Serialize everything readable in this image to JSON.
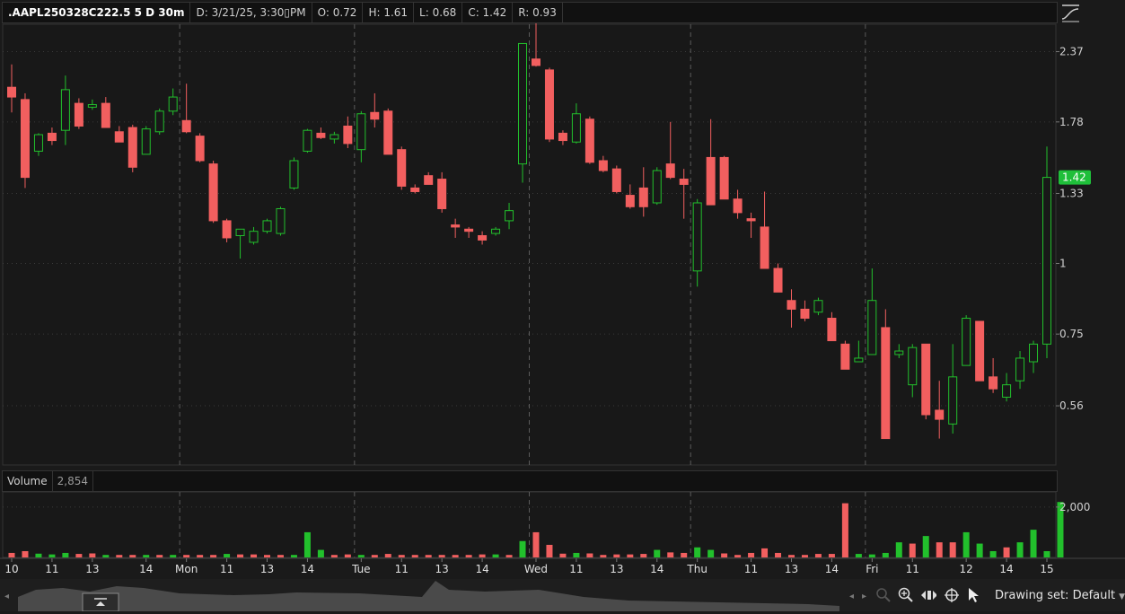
{
  "header": {
    "symbol": ".AAPL250328C222.5 5 D 30m",
    "date": "D: 3/21/25, 3:30▯PM",
    "open": "O: 0.72",
    "high": "H: 1.61",
    "low": "L: 0.68",
    "close": "C: 1.42",
    "range": "R: 0.93"
  },
  "volume_header": {
    "label": "Volume",
    "value": "2,854"
  },
  "price_axis": {
    "ticks": [
      "2.37",
      "1.78",
      "1.33",
      "1",
      "0.75",
      "0.56"
    ],
    "last_price": "1.42",
    "last_price_color": "#1fbf3a"
  },
  "volume_axis": {
    "ticks": [
      "2,000"
    ]
  },
  "colors": {
    "up": "#22c02c",
    "down": "#f25f5f",
    "background": "#1a1a1a",
    "grid": "#3a3a3a"
  },
  "bottom": {
    "drawing_set": "Drawing set: Default"
  },
  "icons": [
    "chart-style-icon",
    "zoom-icon",
    "pan-icon",
    "crosshair-icon",
    "cursor-icon"
  ],
  "chart_data": {
    "type": "candlestick",
    "scale": "log",
    "ylim": [
      0.44,
      2.65
    ],
    "x_labels": [
      "10",
      "11",
      "13",
      "14",
      "Mon",
      "11",
      "13",
      "14",
      "Tue",
      "11",
      "13",
      "14",
      "Wed",
      "11",
      "13",
      "14",
      "Thu",
      "11",
      "13",
      "14",
      "Fri",
      "11",
      "12",
      "14",
      "15"
    ],
    "session_breaks": [
      "Mon",
      "Tue",
      "Wed",
      "Thu",
      "Fri"
    ],
    "candles": [
      [
        2.05,
        2.25,
        1.85,
        1.97
      ],
      [
        1.95,
        2.0,
        1.36,
        1.42
      ],
      [
        1.58,
        1.7,
        1.55,
        1.69
      ],
      [
        1.7,
        1.74,
        1.62,
        1.65
      ],
      [
        1.72,
        2.15,
        1.62,
        2.03
      ],
      [
        1.92,
        1.96,
        1.73,
        1.75
      ],
      [
        1.89,
        1.95,
        1.87,
        1.91
      ],
      [
        1.92,
        1.97,
        1.74,
        1.74
      ],
      [
        1.71,
        1.75,
        1.64,
        1.64
      ],
      [
        1.74,
        1.76,
        1.45,
        1.48
      ],
      [
        1.56,
        1.75,
        1.56,
        1.73
      ],
      [
        1.71,
        1.88,
        1.69,
        1.86
      ],
      [
        1.86,
        2.04,
        1.83,
        1.97
      ],
      [
        1.79,
        2.08,
        1.7,
        1.71
      ],
      [
        1.68,
        1.7,
        1.51,
        1.52
      ],
      [
        1.5,
        1.52,
        1.18,
        1.19
      ],
      [
        1.19,
        1.2,
        1.09,
        1.11
      ],
      [
        1.12,
        1.15,
        1.02,
        1.15
      ],
      [
        1.09,
        1.16,
        1.08,
        1.14
      ],
      [
        1.14,
        1.2,
        1.13,
        1.19
      ],
      [
        1.13,
        1.26,
        1.12,
        1.25
      ],
      [
        1.36,
        1.54,
        1.35,
        1.52
      ],
      [
        1.58,
        1.73,
        1.57,
        1.72
      ],
      [
        1.7,
        1.74,
        1.66,
        1.67
      ],
      [
        1.66,
        1.71,
        1.63,
        1.69
      ],
      [
        1.75,
        1.82,
        1.6,
        1.63
      ],
      [
        1.59,
        1.86,
        1.51,
        1.84
      ],
      [
        1.85,
        2.0,
        1.74,
        1.8
      ],
      [
        1.86,
        1.88,
        1.56,
        1.56
      ],
      [
        1.59,
        1.61,
        1.35,
        1.37
      ],
      [
        1.36,
        1.38,
        1.33,
        1.34
      ],
      [
        1.43,
        1.45,
        1.38,
        1.38
      ],
      [
        1.41,
        1.45,
        1.23,
        1.25
      ],
      [
        1.17,
        1.2,
        1.11,
        1.16
      ],
      [
        1.15,
        1.16,
        1.11,
        1.14
      ],
      [
        1.12,
        1.14,
        1.08,
        1.1
      ],
      [
        1.13,
        1.16,
        1.12,
        1.15
      ],
      [
        1.19,
        1.28,
        1.15,
        1.24
      ],
      [
        1.5,
        2.43,
        1.39,
        2.45
      ],
      [
        2.3,
        2.82,
        2.23,
        2.24
      ],
      [
        2.2,
        2.22,
        1.64,
        1.66
      ],
      [
        1.7,
        1.72,
        1.62,
        1.65
      ],
      [
        1.64,
        1.92,
        1.63,
        1.84
      ],
      [
        1.8,
        1.82,
        1.5,
        1.51
      ],
      [
        1.52,
        1.55,
        1.45,
        1.46
      ],
      [
        1.47,
        1.49,
        1.33,
        1.34
      ],
      [
        1.32,
        1.38,
        1.25,
        1.26
      ],
      [
        1.36,
        1.48,
        1.21,
        1.26
      ],
      [
        1.28,
        1.48,
        1.27,
        1.46
      ],
      [
        1.5,
        1.78,
        1.41,
        1.42
      ],
      [
        1.41,
        1.47,
        1.2,
        1.38
      ],
      [
        0.97,
        1.3,
        0.91,
        1.28
      ],
      [
        1.54,
        1.8,
        1.31,
        1.27
      ],
      [
        1.54,
        1.55,
        1.3,
        1.3
      ],
      [
        1.3,
        1.35,
        1.2,
        1.23
      ],
      [
        1.2,
        1.23,
        1.11,
        1.19
      ],
      [
        1.16,
        1.34,
        1.05,
        0.98
      ],
      [
        0.98,
        1.0,
        0.89,
        0.89
      ],
      [
        0.86,
        0.9,
        0.77,
        0.83
      ],
      [
        0.83,
        0.86,
        0.79,
        0.8
      ],
      [
        0.82,
        0.87,
        0.81,
        0.86
      ],
      [
        0.8,
        0.82,
        0.73,
        0.73
      ],
      [
        0.72,
        0.73,
        0.65,
        0.65
      ],
      [
        0.67,
        0.73,
        0.67,
        0.68
      ],
      [
        0.69,
        0.98,
        0.69,
        0.86
      ],
      [
        0.77,
        0.83,
        0.49,
        0.49
      ],
      [
        0.69,
        0.72,
        0.68,
        0.7
      ],
      [
        0.61,
        0.72,
        0.58,
        0.71
      ],
      [
        0.72,
        0.72,
        0.53,
        0.54
      ],
      [
        0.55,
        0.62,
        0.49,
        0.53
      ],
      [
        0.52,
        0.72,
        0.5,
        0.63
      ],
      [
        0.66,
        0.81,
        0.66,
        0.8
      ],
      [
        0.79,
        0.79,
        0.62,
        0.62
      ],
      [
        0.63,
        0.68,
        0.59,
        0.6
      ],
      [
        0.58,
        0.64,
        0.57,
        0.61
      ],
      [
        0.62,
        0.7,
        0.6,
        0.68
      ],
      [
        0.67,
        0.73,
        0.64,
        0.72
      ],
      [
        0.72,
        1.61,
        0.68,
        1.42
      ]
    ],
    "volume": [
      [
        18,
        "down"
      ],
      [
        25,
        "down"
      ],
      [
        15,
        "up"
      ],
      [
        12,
        "up"
      ],
      [
        18,
        "up"
      ],
      [
        14,
        "down"
      ],
      [
        16,
        "down"
      ],
      [
        10,
        "up"
      ],
      [
        10,
        "down"
      ],
      [
        10,
        "down"
      ],
      [
        10,
        "up"
      ],
      [
        10,
        "down"
      ],
      [
        10,
        "up"
      ],
      [
        10,
        "down"
      ],
      [
        10,
        "down"
      ],
      [
        10,
        "down"
      ],
      [
        14,
        "up"
      ],
      [
        12,
        "down"
      ],
      [
        12,
        "down"
      ],
      [
        10,
        "down"
      ],
      [
        10,
        "down"
      ],
      [
        10,
        "up"
      ],
      [
        100,
        "up"
      ],
      [
        30,
        "up"
      ],
      [
        10,
        "down"
      ],
      [
        12,
        "down"
      ],
      [
        10,
        "up"
      ],
      [
        10,
        "down"
      ],
      [
        14,
        "down"
      ],
      [
        10,
        "down"
      ],
      [
        10,
        "down"
      ],
      [
        10,
        "down"
      ],
      [
        10,
        "down"
      ],
      [
        10,
        "down"
      ],
      [
        10,
        "down"
      ],
      [
        12,
        "down"
      ],
      [
        12,
        "up"
      ],
      [
        10,
        "down"
      ],
      [
        65,
        "up"
      ],
      [
        100,
        "down"
      ],
      [
        50,
        "down"
      ],
      [
        15,
        "down"
      ],
      [
        18,
        "up"
      ],
      [
        16,
        "down"
      ],
      [
        10,
        "down"
      ],
      [
        12,
        "down"
      ],
      [
        12,
        "down"
      ],
      [
        14,
        "down"
      ],
      [
        30,
        "up"
      ],
      [
        20,
        "down"
      ],
      [
        18,
        "down"
      ],
      [
        40,
        "up"
      ],
      [
        30,
        "up"
      ],
      [
        16,
        "down"
      ],
      [
        10,
        "down"
      ],
      [
        18,
        "down"
      ],
      [
        36,
        "down"
      ],
      [
        18,
        "down"
      ],
      [
        10,
        "down"
      ],
      [
        10,
        "down"
      ],
      [
        14,
        "down"
      ],
      [
        14,
        "down"
      ],
      [
        215,
        "down"
      ],
      [
        14,
        "up"
      ],
      [
        12,
        "up"
      ],
      [
        18,
        "up"
      ],
      [
        60,
        "up"
      ],
      [
        55,
        "down"
      ],
      [
        85,
        "up"
      ],
      [
        60,
        "down"
      ],
      [
        60,
        "down"
      ],
      [
        100,
        "up"
      ],
      [
        55,
        "up"
      ],
      [
        25,
        "up"
      ],
      [
        40,
        "down"
      ],
      [
        60,
        "up"
      ],
      [
        110,
        "up"
      ],
      [
        25,
        "up"
      ],
      [
        220,
        "up"
      ]
    ]
  }
}
